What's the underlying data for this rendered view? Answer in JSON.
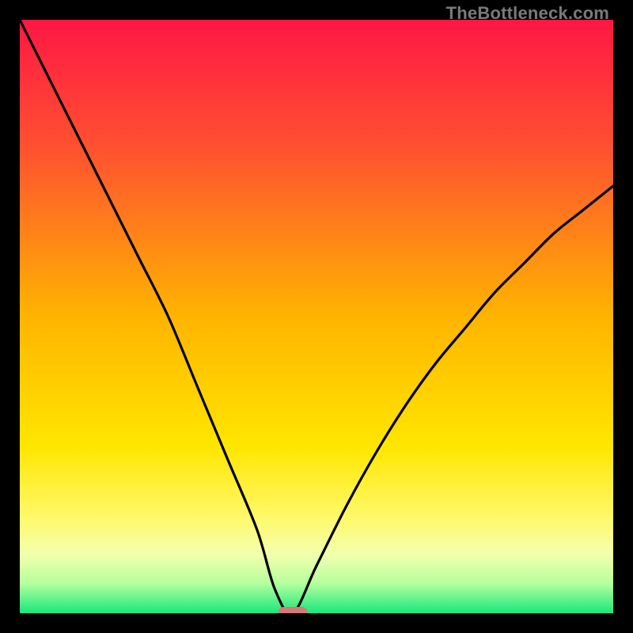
{
  "watermark": "TheBottleneck.com",
  "chart_data": {
    "type": "line",
    "title": "",
    "xlabel": "",
    "ylabel": "",
    "xlim": [
      0,
      100
    ],
    "ylim": [
      0,
      100
    ],
    "grid": false,
    "series": [
      {
        "name": "bottleneck-curve",
        "x": [
          0,
          5,
          10,
          15,
          20,
          25,
          30,
          35,
          40,
          43,
          46,
          50,
          55,
          60,
          65,
          70,
          75,
          80,
          85,
          90,
          95,
          100
        ],
        "values": [
          100,
          90,
          80,
          70,
          60,
          50,
          38,
          26,
          14,
          4,
          0,
          8,
          18,
          27,
          35,
          42,
          48,
          54,
          59,
          64,
          68,
          72
        ]
      }
    ],
    "marker": {
      "x": 46,
      "y": 0
    },
    "legend": false,
    "background_gradient": {
      "stops": [
        {
          "offset": 0.0,
          "color": "#ff1744"
        },
        {
          "offset": 0.22,
          "color": "#ff5230"
        },
        {
          "offset": 0.5,
          "color": "#ffb400"
        },
        {
          "offset": 0.72,
          "color": "#ffe600"
        },
        {
          "offset": 0.84,
          "color": "#fff96b"
        },
        {
          "offset": 0.9,
          "color": "#f3ffad"
        },
        {
          "offset": 0.95,
          "color": "#b4ff9e"
        },
        {
          "offset": 1.0,
          "color": "#17e87c"
        }
      ]
    }
  }
}
